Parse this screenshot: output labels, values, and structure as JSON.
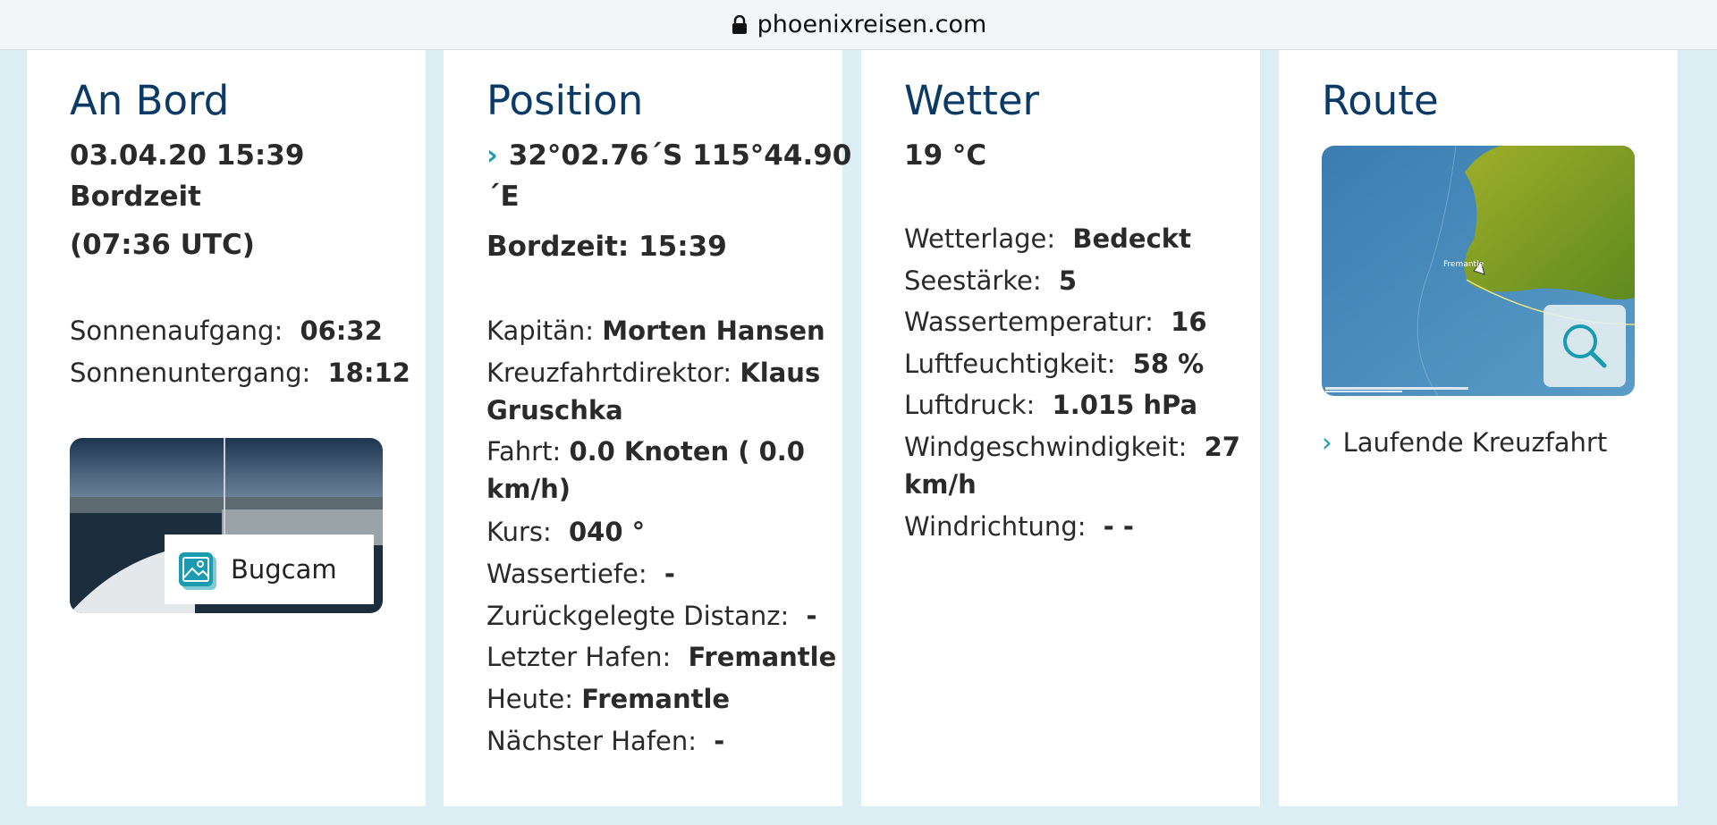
{
  "browser": {
    "url": "phoenixreisen.com"
  },
  "an_bord": {
    "title": "An Bord",
    "datetime": "03.04.20 15:39",
    "bordzeit": "Bordzeit",
    "utc": "(07:36 UTC)",
    "sunrise_label": "Sonnenaufgang:",
    "sunrise_value": "06:32",
    "sunset_label": "Sonnenuntergang:",
    "sunset_value": "18:12",
    "bugcam_label": "Bugcam"
  },
  "position": {
    "title": "Position",
    "coord_line1": "32°02.76´S 115°44.90",
    "coord_line2": "´E",
    "bordzeit": "Bordzeit: 15:39",
    "captain_label": "Kapitän:",
    "captain_value": "Morten Hansen",
    "director_label": "Kreuzfahrtdirektor:",
    "director_value1": "Klaus",
    "director_value2": "Gruschka",
    "speed_label": "Fahrt:",
    "speed_value1": "0.0 Knoten ( 0.0",
    "speed_value2": "km/h)",
    "course_label": "Kurs:",
    "course_value": "040 °",
    "depth_label": "Wassertiefe:",
    "depth_value": "-",
    "distance_label": "Zurückgelegte Distanz:",
    "distance_value": "-",
    "last_port_label": "Letzter Hafen:",
    "last_port_value": "Fremantle",
    "today_label": "Heute:",
    "today_value": "Fremantle",
    "next_port_label": "Nächster Hafen:",
    "next_port_value": "-"
  },
  "wetter": {
    "title": "Wetter",
    "temperature": "19 °C",
    "condition_label": "Wetterlage:",
    "condition_value": "Bedeckt",
    "sea_label": "Seestärke:",
    "sea_value": "5",
    "water_temp_label": "Wassertemperatur:",
    "water_temp_value": "16",
    "humidity_label": "Luftfeuchtigkeit:",
    "humidity_value": "58 %",
    "pressure_label": "Luftdruck:",
    "pressure_value": "1.015 hPa",
    "wind_speed_label": "Windgeschwindigkeit:",
    "wind_speed_value1": "27",
    "wind_speed_value2": "km/h",
    "wind_dir_label": "Windrichtung:",
    "wind_dir_value": "- -"
  },
  "route": {
    "title": "Route",
    "map_label": "Fremantle",
    "link": "Laufende Kreuzfahrt"
  },
  "colors": {
    "title_blue": "#0b3a66",
    "accent_teal": "#1a9bb0",
    "page_bg": "#dbeef4"
  }
}
